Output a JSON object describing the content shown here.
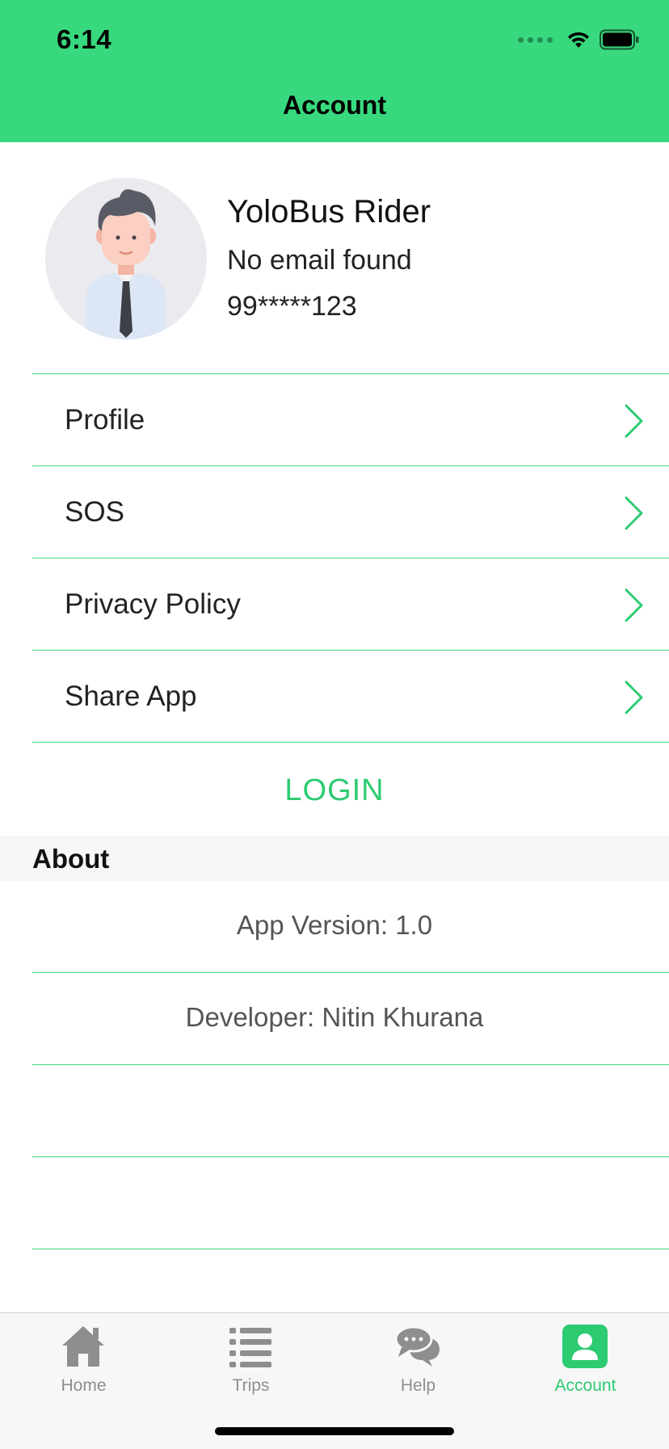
{
  "status_bar": {
    "time": "6:14"
  },
  "header": {
    "title": "Account",
    "background": "#38D97E"
  },
  "profile": {
    "name": "YoloBus Rider",
    "email": "No email found",
    "phone": "99*****123"
  },
  "menu": {
    "items": [
      {
        "label": "Profile"
      },
      {
        "label": "SOS"
      },
      {
        "label": "Privacy Policy"
      },
      {
        "label": "Share App"
      }
    ],
    "login_label": "LOGIN"
  },
  "about": {
    "title": "About",
    "items": [
      {
        "text": "App Version: 1.0"
      },
      {
        "text": "Developer: Nitin Khurana"
      },
      {
        "text": ""
      },
      {
        "text": ""
      }
    ]
  },
  "tabbar": {
    "tabs": [
      {
        "label": "Home",
        "icon": "home-icon"
      },
      {
        "label": "Trips",
        "icon": "list-icon"
      },
      {
        "label": "Help",
        "icon": "chat-bubbles-icon"
      },
      {
        "label": "Account",
        "icon": "account-icon"
      }
    ],
    "active": "Account",
    "active_color": "#2DCB71",
    "inactive_color": "#8E8E8E"
  }
}
